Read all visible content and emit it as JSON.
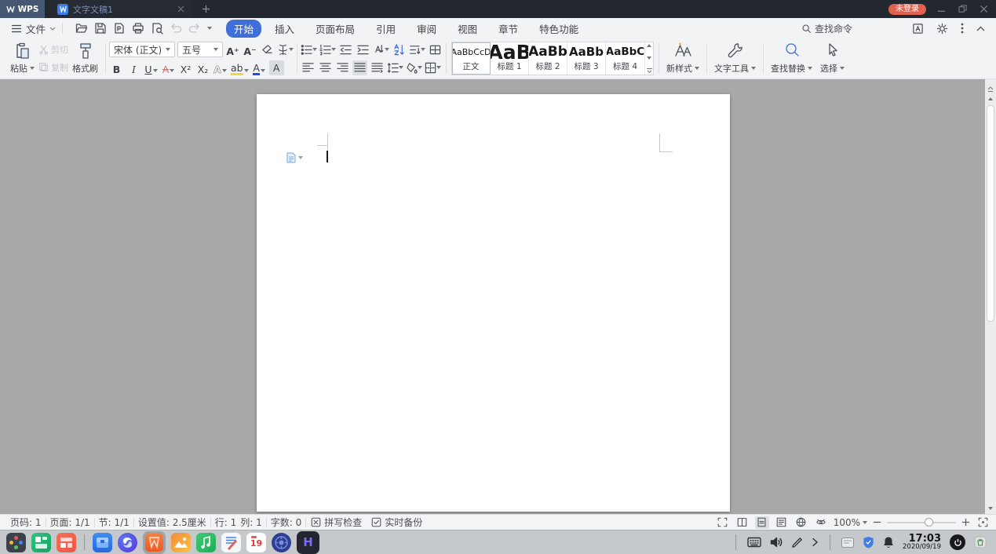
{
  "colors": {
    "accent_blue": "#3f6fd8",
    "badge_red": "#e0614f",
    "titlebar_bg": "#23272e",
    "logo_slate": "#465871",
    "toolbar_bg": "#f2f3f5",
    "canvas_gray": "#a8a8a8",
    "taskbar_gray": "#c6c9cc"
  },
  "titlebar": {
    "app_name": "WPS",
    "document_tab": "文字文稿1",
    "login_status": "未登录"
  },
  "menubar": {
    "file_menu": "文件",
    "tabs": [
      {
        "label": "开始",
        "active": true
      },
      {
        "label": "插入"
      },
      {
        "label": "页面布局"
      },
      {
        "label": "引用"
      },
      {
        "label": "审阅"
      },
      {
        "label": "视图"
      },
      {
        "label": "章节"
      },
      {
        "label": "特色功能"
      }
    ],
    "search_command": "查找命令"
  },
  "toolbar": {
    "paste": "粘贴",
    "cut": "剪切",
    "copy": "复制",
    "format_painter": "格式刷",
    "font_name": "宋体 (正文)",
    "font_size": "五号",
    "grow_font": "A⁺",
    "shrink_font": "A⁻",
    "bold": "B",
    "italic": "I",
    "underline": "U",
    "strikethrough": "A",
    "superscript": "X²",
    "subscript": "X₂",
    "text_effects": "A",
    "highlight": "ab",
    "font_color": "A",
    "char_shading": "A",
    "styles": [
      {
        "preview": "AaBbCcD",
        "label": "正文"
      },
      {
        "preview": "AaB",
        "label": "标题 1"
      },
      {
        "preview": "AaBb",
        "label": "标题 2"
      },
      {
        "preview": "AaBb",
        "label": "标题 3"
      },
      {
        "preview": "AaBbC",
        "label": "标题 4"
      }
    ],
    "new_style": "新样式",
    "text_tool": "文字工具",
    "find_replace": "查找替换",
    "select": "选择"
  },
  "statusbar": {
    "page_number": "页码: 1",
    "page_count": "页面: 1/1",
    "section": "节: 1/1",
    "setting": "设置值: 2.5厘米",
    "line": "行: 1",
    "column": "列: 1",
    "word_count": "字数: 0",
    "spell_check": "拼写检查",
    "backup": "实时备份",
    "zoom_level": "100%"
  },
  "taskbar": {
    "calendar_day": "19",
    "app_h": "H",
    "time": "17:03",
    "date": "2020/09/19"
  }
}
